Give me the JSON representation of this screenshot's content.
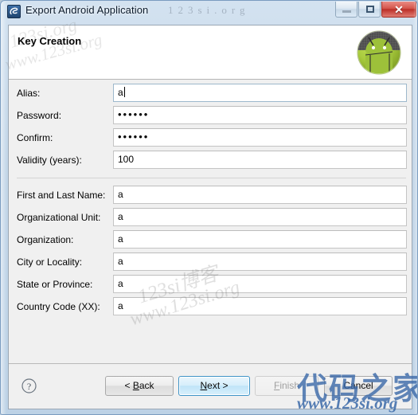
{
  "window": {
    "title": "Export Android Application",
    "app_icon": "eclipse-icon",
    "controls": {
      "minimize": "minimize-icon",
      "maximize": "restore-icon",
      "close": "✕"
    }
  },
  "header": {
    "title": "Key Creation",
    "logo": "android-robot-logo"
  },
  "form": {
    "groups": [
      {
        "fields": [
          {
            "label": "Alias:",
            "value": "a",
            "type": "text",
            "focused": true
          },
          {
            "label": "Password:",
            "value": "••••••",
            "type": "password",
            "focused": false
          },
          {
            "label": "Confirm:",
            "value": "••••••",
            "type": "password",
            "focused": false
          },
          {
            "label": "Validity (years):",
            "value": "100",
            "type": "text",
            "focused": false
          }
        ]
      },
      {
        "fields": [
          {
            "label": "First and Last Name:",
            "value": "a",
            "type": "text",
            "focused": false
          },
          {
            "label": "Organizational Unit:",
            "value": "a",
            "type": "text",
            "focused": false
          },
          {
            "label": "Organization:",
            "value": "a",
            "type": "text",
            "focused": false
          },
          {
            "label": "City or Locality:",
            "value": "a",
            "type": "text",
            "focused": false
          },
          {
            "label": "State or Province:",
            "value": "a",
            "type": "text",
            "focused": false
          },
          {
            "label": "Country Code (XX):",
            "value": "a",
            "type": "text",
            "focused": false
          }
        ]
      }
    ]
  },
  "buttonbar": {
    "help": "help-icon",
    "back": "< Back",
    "next": "Next >",
    "finish": "Finish",
    "cancel": "Cancel"
  },
  "watermarks": {
    "site_cn": "123si博客",
    "site_url": "www.123si.org",
    "brand_cn": "代码之家",
    "brand_url": "www.123si.org",
    "faint_top": "123si.org"
  },
  "colors": {
    "accent": "#3e94c7",
    "android_green": "#a4c739",
    "close_red": "#bb2f28",
    "panel": "#f0f0f0"
  }
}
